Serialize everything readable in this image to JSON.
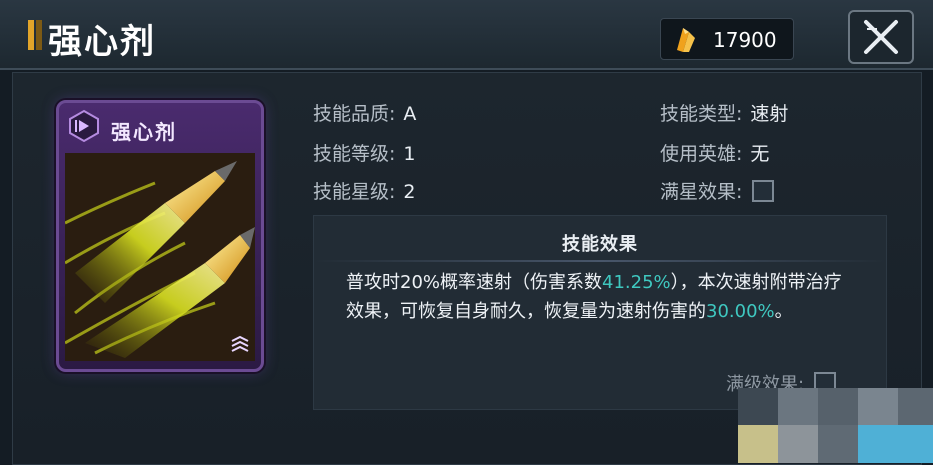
{
  "header": {
    "title": "强心剂",
    "currency_value": "17900"
  },
  "card": {
    "name": "强心剂"
  },
  "stats": {
    "quality_label": "技能品质:",
    "quality_value": "A",
    "level_label": "技能等级:",
    "level_value": "1",
    "star_label": "技能星级:",
    "star_value": "2",
    "type_label": "技能类型:",
    "type_value": "速射",
    "hero_label": "使用英雄:",
    "hero_value": "无",
    "maxstar_label": "满星效果:"
  },
  "effect": {
    "title": "技能效果",
    "text_1": "普攻时20%概率速射（伤害系数",
    "highlight_1": "41.25%",
    "text_2": "），本次速射附带治疗效果，可恢复自身耐久，恢复量为速射伤害的",
    "highlight_2": "30.00%",
    "text_3": "。",
    "max_level_label": "满级效果:"
  },
  "colors": {
    "highlight": "#3fc8c0",
    "title_mark": "#e2a52a",
    "card_purple": "#4a2b6e"
  },
  "icons": {
    "currency": "crystal-icon",
    "close": "close-icon",
    "card_badge": "skill-type-badge-icon"
  }
}
